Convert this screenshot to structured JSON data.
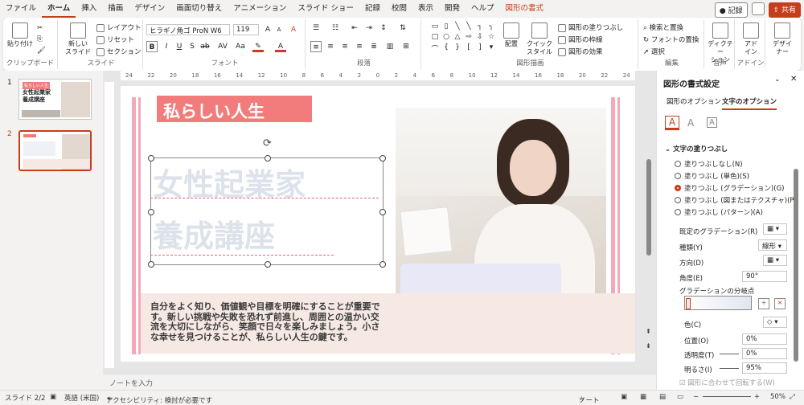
{
  "menu": {
    "tabs": [
      "ファイル",
      "ホーム",
      "挿入",
      "描画",
      "デザイン",
      "画面切り替え",
      "アニメーション",
      "スライド ショー",
      "記録",
      "校閲",
      "表示",
      "開発",
      "ヘルプ",
      "図形の書式"
    ],
    "record": "記録",
    "share": "共有"
  },
  "ribbon": {
    "paste": "貼り付け",
    "clipboard": "クリップボード",
    "new_slide": "新しい\nスライド",
    "layout": "レイアウト",
    "reset": "リセット",
    "section": "セクション",
    "slides": "スライド",
    "font_name": "ヒラギノ角ゴ ProN W6",
    "font_size": "119",
    "font": "フォント",
    "paragraph": "段落",
    "arrange": "配置",
    "quick_style": "クイック\nスタイル",
    "fill": "図形の塗りつぶし",
    "outline": "図形の枠線",
    "effects": "図形の効果",
    "drawing": "図形描画",
    "find": "検索と置換",
    "replace_font": "フォントの置換",
    "select": "選択",
    "editing": "編集",
    "dictation": "ディクテー\nション",
    "voice": "音声",
    "addin": "アド\nイン",
    "addins": "アドイン",
    "designer": "デザイ\nナー"
  },
  "thumbs": [
    {
      "num": "1",
      "title": "女性起業家\n養成講座",
      "tag": "私らしい人生"
    },
    {
      "num": "2"
    }
  ],
  "ruler": [
    "24",
    "22",
    "20",
    "18",
    "16",
    "14",
    "12",
    "10",
    "8",
    "6",
    "4",
    "2",
    "0",
    "2",
    "4",
    "6",
    "8",
    "10",
    "12",
    "14",
    "16",
    "18",
    "20",
    "22",
    "24"
  ],
  "slide": {
    "tag": "私らしい人生",
    "ghost_line1": "女性起業家",
    "ghost_line2": "養成講座",
    "paragraph": "自分をよく知り、価値観や目標を明確にすることが重要です。新しい挑戦や失敗を恐れず前進し、周囲との温かい交流を大切にしながら、笑顔で日々を楽しみましょう。小さな幸せを見つけることが、私らしい人生の鍵です。"
  },
  "notes_placeholder": "ノートを入力",
  "panel": {
    "title": "図形の書式設定",
    "tab_shape": "図形のオプション",
    "tab_text": "文字のオプション",
    "section": "文字の塗りつぶし",
    "options": [
      "塗りつぶしなし(N)",
      "塗りつぶし (単色)(S)",
      "塗りつぶし (グラデーション)(G)",
      "塗りつぶし (図またはテクスチャ)(P)",
      "塗りつぶし (パターン)(A)"
    ],
    "selected_option": 2,
    "preset_label": "既定のグラデーション(R)",
    "type_label": "種類(Y)",
    "type_value": "線形",
    "direction_label": "方向(D)",
    "angle_label": "角度(E)",
    "angle_value": "90°",
    "stops_label": "グラデーションの分岐点",
    "color_label": "色(C)",
    "position_label": "位置(O)",
    "position_value": "0%",
    "transparency_label": "透明度(T)",
    "transparency_value": "0%",
    "brightness_label": "明るさ(I)",
    "brightness_value": "95%",
    "rotate_label": "図形に合わせて回転する(W)"
  },
  "status": {
    "slide": "スライド 2/2",
    "lang": "英語 (米国)",
    "accessibility": "アクセシビリティ: 検討が必要です",
    "notes": "ノート",
    "zoom": "50%"
  },
  "colors": {
    "accent": "#c43e1c",
    "pink_bar": "#f4a9ba",
    "tag_bg": "#f27c7c"
  }
}
